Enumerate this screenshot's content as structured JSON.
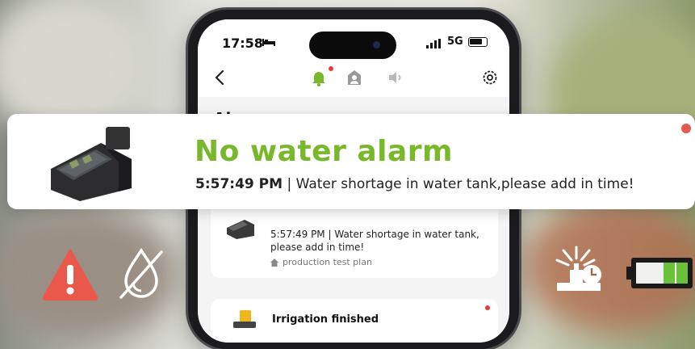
{
  "status_bar": {
    "time": "17:58",
    "network": "5G"
  },
  "page": {
    "title": "Alarm"
  },
  "banner": {
    "title": "No water alarm",
    "time": "5:57:49 PM",
    "separator": " | ",
    "message": "Water shortage in water tank,please add in time!"
  },
  "alarms": [
    {
      "time": "5:57:49 PM",
      "message": "Water shortage in water tank, please add in time!",
      "plan": "production test plan"
    },
    {
      "title": "Irrigation finished"
    }
  ],
  "colors": {
    "accent": "#78b82a",
    "alert": "#e83a34",
    "warning": "#e9584a",
    "battery_fill": "#6cc13a"
  },
  "icons": [
    "back-arrow-icon",
    "bell-icon",
    "user-icon",
    "speaker-icon",
    "settings-icon",
    "filter-icon",
    "home-icon",
    "warning-icon",
    "no-water-drop-icon",
    "sprinkler-timer-icon",
    "low-battery-icon"
  ],
  "battery_level": 0.45
}
